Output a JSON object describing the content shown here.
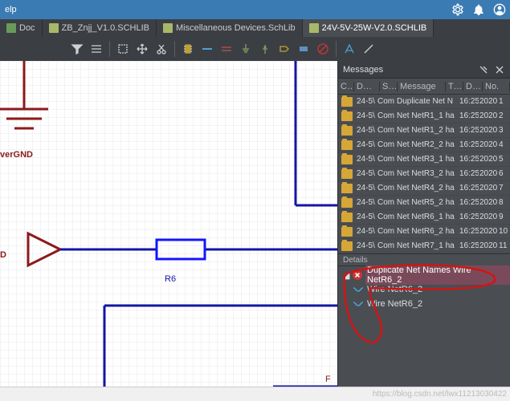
{
  "menu": {
    "help": "elp"
  },
  "tabs": [
    {
      "label": "Doc",
      "active": false,
      "kind": "doc"
    },
    {
      "label": "ZB_Znjj_V1.0.SCHLIB",
      "active": false,
      "kind": "lib"
    },
    {
      "label": "Miscellaneous Devices.SchLib",
      "active": false,
      "kind": "lib"
    },
    {
      "label": "24V-5V-25W-V2.0.SCHLIB",
      "active": true,
      "kind": "lib"
    }
  ],
  "schematic": {
    "gnd_label": "verGND",
    "port_label": "D",
    "ref_des": "R6",
    "partial_label": "F"
  },
  "messages": {
    "title": "Messages",
    "columns": [
      "Cl...",
      "Docu...",
      "So...",
      "Message",
      "Ti...",
      "Da...",
      "No."
    ],
    "rows": [
      {
        "cls": "24-5\\",
        "src": "Com",
        "msg": "Duplicate Net N",
        "ti": "16:25",
        "da": "2020",
        "no": "1"
      },
      {
        "cls": "24-5\\",
        "src": "Com",
        "msg": "Net NetR1_1 ha",
        "ti": "16:25",
        "da": "2020",
        "no": "2"
      },
      {
        "cls": "24-5\\",
        "src": "Com",
        "msg": "Net NetR1_2 ha",
        "ti": "16:25",
        "da": "2020",
        "no": "3"
      },
      {
        "cls": "24-5\\",
        "src": "Com",
        "msg": "Net NetR2_2 ha",
        "ti": "16:25",
        "da": "2020",
        "no": "4"
      },
      {
        "cls": "24-5\\",
        "src": "Com",
        "msg": "Net NetR3_1 ha",
        "ti": "16:25",
        "da": "2020",
        "no": "5"
      },
      {
        "cls": "24-5\\",
        "src": "Com",
        "msg": "Net NetR3_2 ha",
        "ti": "16:25",
        "da": "2020",
        "no": "6"
      },
      {
        "cls": "24-5\\",
        "src": "Com",
        "msg": "Net NetR4_2 ha",
        "ti": "16:25",
        "da": "2020",
        "no": "7"
      },
      {
        "cls": "24-5\\",
        "src": "Com",
        "msg": "Net NetR5_2 ha",
        "ti": "16:25",
        "da": "2020",
        "no": "8"
      },
      {
        "cls": "24-5\\",
        "src": "Com",
        "msg": "Net NetR6_1 ha",
        "ti": "16:25",
        "da": "2020",
        "no": "9"
      },
      {
        "cls": "24-5\\",
        "src": "Com",
        "msg": "Net NetR6_2 ha",
        "ti": "16:25",
        "da": "2020",
        "no": "10"
      },
      {
        "cls": "24-5\\",
        "src": "Com",
        "msg": "Net NetR7_1 ha",
        "ti": "16:25",
        "da": "2020",
        "no": "11"
      }
    ],
    "details_title": "Details",
    "details": [
      {
        "type": "error",
        "text": "Duplicate Net Names Wire NetR6_2",
        "selected": true
      },
      {
        "type": "wire",
        "text": "Wire NetR6_2",
        "selected": false
      },
      {
        "type": "wire",
        "text": "Wire NetR6_2",
        "selected": false
      }
    ]
  },
  "statusbar": {
    "url": "https://blog.csdn.net/lwx11213030422"
  }
}
